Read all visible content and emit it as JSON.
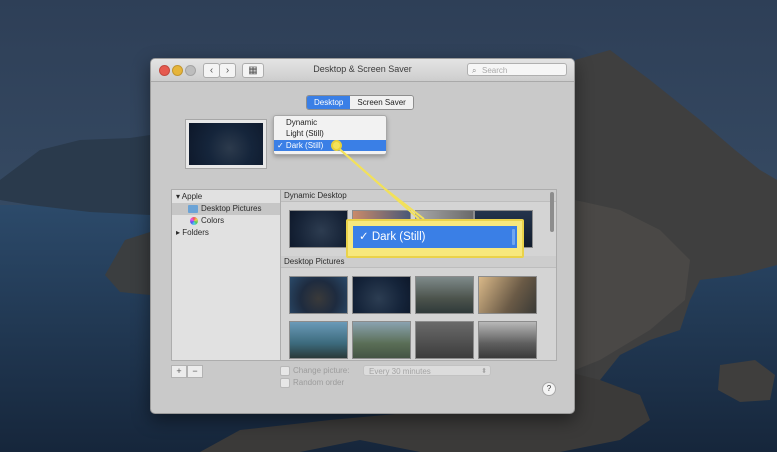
{
  "window": {
    "title": "Desktop & Screen Saver"
  },
  "toolbar": {
    "back_icon": "‹",
    "forward_icon": "›",
    "grid_icon": "▦"
  },
  "search": {
    "placeholder": "Search",
    "icon": "⌕"
  },
  "tabs": [
    {
      "label": "Desktop",
      "selected": true
    },
    {
      "label": "Screen Saver",
      "selected": false
    }
  ],
  "appearance_menu": {
    "items": [
      {
        "label": "Dynamic"
      },
      {
        "label": "Light (Still)"
      },
      {
        "label": "✓ Dark (Still)",
        "selected": true
      }
    ]
  },
  "callout": {
    "label": "✓ Dark (Still)"
  },
  "sidebar": {
    "apple": "▾ Apple",
    "desktop_pictures": "Desktop Pictures",
    "colors": "Colors",
    "folders": "▸ Folders"
  },
  "sections": {
    "dynamic_desktop": "Dynamic Desktop",
    "desktop_pictures": "Desktop Pictures"
  },
  "bottom": {
    "add_label": "+",
    "remove_label": "−",
    "change_picture": "Change picture:",
    "interval": "Every 30 minutes",
    "random_order": "Random order",
    "help": "?"
  },
  "colors": {
    "accent": "#3a7fe6",
    "highlight": "#f7e87d"
  }
}
